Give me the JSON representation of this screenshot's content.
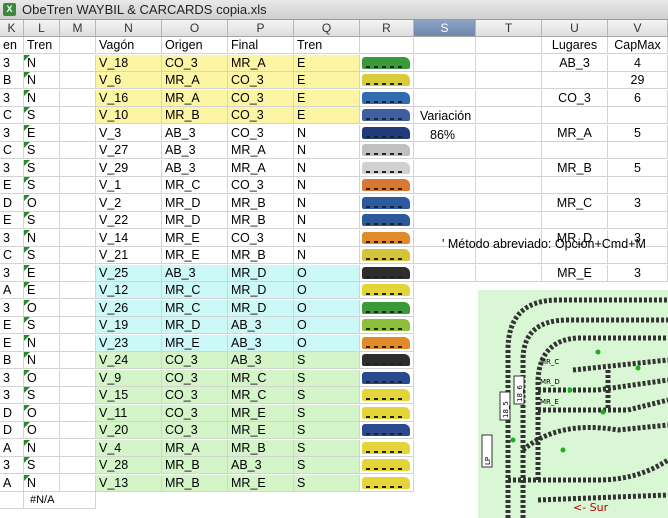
{
  "window": {
    "title": "ObeTren WAYBIL & CARCARDS copia.xls",
    "app_icon": "excel-icon"
  },
  "columns": [
    "K",
    "L",
    "M",
    "N",
    "O",
    "P",
    "Q",
    "R",
    "S",
    "T",
    "U",
    "V"
  ],
  "selected_column": "S",
  "headers": {
    "k": "en",
    "l": "Tren",
    "n": "Vagón",
    "o": "Origen",
    "p": "Final",
    "q": "Tren"
  },
  "rows": [
    {
      "k": "3",
      "l": "N",
      "n": "V_18",
      "o": "CO_3",
      "p": "MR_A",
      "q": "E",
      "band": "y",
      "train": "#3a9a3a"
    },
    {
      "k": "B",
      "l": "N",
      "n": "V_6",
      "o": "MR_A",
      "p": "CO_3",
      "q": "E",
      "band": "y",
      "train": "#d9cc3a"
    },
    {
      "k": "3",
      "l": "N",
      "n": "V_16",
      "o": "MR_A",
      "p": "CO_3",
      "q": "E",
      "band": "y",
      "train": "#2f6db0"
    },
    {
      "k": "C",
      "l": "S",
      "n": "V_10",
      "o": "MR_B",
      "p": "CO_3",
      "q": "E",
      "band": "y",
      "train": "#3f5fa0"
    },
    {
      "k": "3",
      "l": "E",
      "n": "V_3",
      "o": "AB_3",
      "p": "CO_3",
      "q": "N",
      "band": "",
      "train": "#213a7a"
    },
    {
      "k": "C",
      "l": "S",
      "n": "V_27",
      "o": "AB_3",
      "p": "MR_A",
      "q": "N",
      "band": "",
      "train": "#c0c0c0"
    },
    {
      "k": "3",
      "l": "S",
      "n": "V_29",
      "o": "AB_3",
      "p": "MR_A",
      "q": "N",
      "band": "",
      "train": "#d0d0d0"
    },
    {
      "k": "E",
      "l": "S",
      "n": "V_1",
      "o": "MR_C",
      "p": "CO_3",
      "q": "N",
      "band": "",
      "train": "#d97830"
    },
    {
      "k": "D",
      "l": "O",
      "n": "V_2",
      "o": "MR_D",
      "p": "MR_B",
      "q": "N",
      "band": "",
      "train": "#2a5aa0"
    },
    {
      "k": "E",
      "l": "S",
      "n": "V_22",
      "o": "MR_D",
      "p": "MR_B",
      "q": "N",
      "band": "",
      "train": "#2a5a9a"
    },
    {
      "k": "3",
      "l": "N",
      "n": "V_14",
      "o": "MR_E",
      "p": "CO_3",
      "q": "N",
      "band": "",
      "train": "#e08a2a"
    },
    {
      "k": "C",
      "l": "S",
      "n": "V_21",
      "o": "MR_E",
      "p": "MR_B",
      "q": "N",
      "band": "",
      "train": "#d4c43a"
    },
    {
      "k": "3",
      "l": "E",
      "n": "V_25",
      "o": "AB_3",
      "p": "MR_D",
      "q": "O",
      "band": "cy",
      "train": "#2d2d2d"
    },
    {
      "k": "A",
      "l": "E",
      "n": "V_12",
      "o": "MR_C",
      "p": "MR_D",
      "q": "O",
      "band": "cy",
      "train": "#e3d43a"
    },
    {
      "k": "3",
      "l": "O",
      "n": "V_26",
      "o": "MR_C",
      "p": "MR_D",
      "q": "O",
      "band": "cy",
      "train": "#3a9a3a"
    },
    {
      "k": "E",
      "l": "S",
      "n": "V_19",
      "o": "MR_D",
      "p": "AB_3",
      "q": "O",
      "band": "cy",
      "train": "#8fbf3a"
    },
    {
      "k": "E",
      "l": "N",
      "n": "V_23",
      "o": "MR_E",
      "p": "AB_3",
      "q": "O",
      "band": "cy",
      "train": "#e08a2a"
    },
    {
      "k": "B",
      "l": "N",
      "n": "V_24",
      "o": "CO_3",
      "p": "AB_3",
      "q": "S",
      "band": "g",
      "train": "#2d2d2d"
    },
    {
      "k": "3",
      "l": "O",
      "n": "V_9",
      "o": "CO_3",
      "p": "MR_C",
      "q": "S",
      "band": "g",
      "train": "#2a4a90"
    },
    {
      "k": "3",
      "l": "S",
      "n": "V_15",
      "o": "CO_3",
      "p": "MR_C",
      "q": "S",
      "band": "g",
      "train": "#e3d43a"
    },
    {
      "k": "D",
      "l": "O",
      "n": "V_11",
      "o": "CO_3",
      "p": "MR_E",
      "q": "S",
      "band": "g",
      "train": "#e3d43a"
    },
    {
      "k": "D",
      "l": "O",
      "n": "V_20",
      "o": "CO_3",
      "p": "MR_E",
      "q": "S",
      "band": "g",
      "train": "#2a4a90"
    },
    {
      "k": "A",
      "l": "N",
      "n": "V_4",
      "o": "MR_A",
      "p": "MR_B",
      "q": "S",
      "band": "g",
      "train": "#e3d43a"
    },
    {
      "k": "3",
      "l": "S",
      "n": "V_28",
      "o": "MR_B",
      "p": "AB_3",
      "q": "S",
      "band": "g",
      "train": "#e3d43a"
    },
    {
      "k": "A",
      "l": "N",
      "n": "V_13",
      "o": "MR_B",
      "p": "MR_E",
      "q": "S",
      "band": "g",
      "train": "#e3d43a"
    }
  ],
  "last_row_l": "#N/A",
  "variation": {
    "label": "Variación",
    "value": "86%"
  },
  "capacity": {
    "header_lugares": "Lugares",
    "header_capmax": "CapMax",
    "rows": [
      {
        "lugar": "AB_3",
        "cap": "4"
      },
      {
        "lugar": "CO_3",
        "cap": "6"
      },
      {
        "lugar": "MR_A",
        "cap": "5"
      },
      {
        "lugar": "MR_B",
        "cap": "5"
      },
      {
        "lugar": "MR_C",
        "cap": "3"
      },
      {
        "lugar": "MR_D",
        "cap": "3"
      },
      {
        "lugar": "MR_E",
        "cap": "3"
      }
    ],
    "total": "29"
  },
  "note": "' Método abreviado: Opción+Cmd+M",
  "track": {
    "labels": [
      "MR_C",
      "MR_D",
      "MR_E",
      "18_5",
      "18_6",
      "LP"
    ],
    "direction": "<- Sur"
  }
}
